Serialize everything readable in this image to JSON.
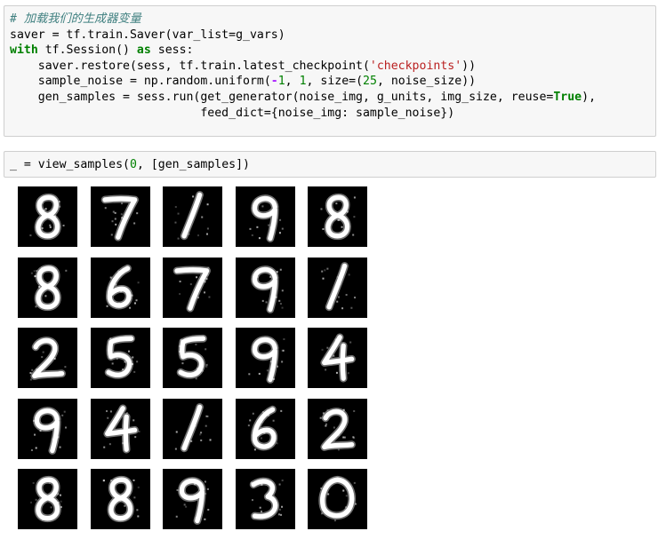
{
  "cell1": {
    "comment": "# 加载我们的生成器变量",
    "line1": "saver = tf.train.Saver(var_list=g_vars)",
    "line2_kw1": "with",
    "line2_mid": " tf.Session() ",
    "line2_kw2": "as",
    "line2_end": " sess:",
    "line3_pre": "    saver.restore(sess, tf.train.latest_checkpoint(",
    "line3_str": "'checkpoints'",
    "line3_post": "))",
    "line4_pre": "    sample_noise = np.random.uniform(",
    "line4_op": "-",
    "line4_n1": "1",
    "line4_mid": ", ",
    "line4_n2": "1",
    "line4_mid2": ", size=(",
    "line4_n3": "25",
    "line4_post": ", noise_size))",
    "line5_pre": "    gen_samples = sess.run(get_generator(noise_img, g_units, img_size, reuse=",
    "line5_kw": "True",
    "line5_post": "),",
    "line6": "                           feed_dict={noise_img: sample_noise})"
  },
  "cell2": {
    "pre": "_ = view_samples(",
    "num": "0",
    "post": ", [gen_samples])"
  },
  "samples": {
    "rows": [
      [
        "8",
        "7",
        "1",
        "9",
        "8"
      ],
      [
        "8",
        "6",
        "7",
        "9",
        "1"
      ],
      [
        "2",
        "5",
        "5",
        "9",
        "4"
      ],
      [
        "9",
        "4",
        "1",
        "6",
        "2"
      ],
      [
        "8",
        "8",
        "9",
        "3",
        "0"
      ]
    ]
  }
}
